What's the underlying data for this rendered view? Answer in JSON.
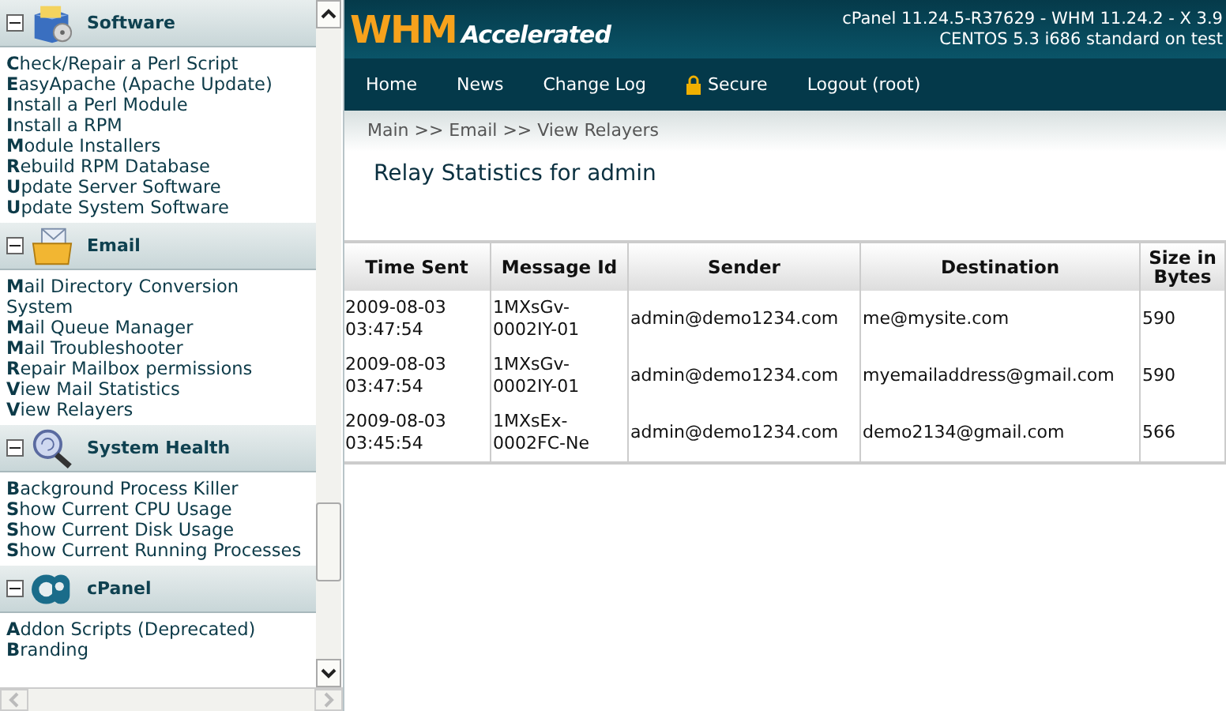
{
  "sidebar": {
    "sections": [
      {
        "title": "Software",
        "kind": "software",
        "expanded": true,
        "items": [
          "**C**heck/Repair a Perl Script",
          "**E**asyApache (Apache Update)",
          "**I**nstall a Perl Module",
          "**I**nstall a RPM",
          "**M**odule Installers",
          "**R**ebuild RPM Database",
          "**U**pdate Server Software",
          "**U**pdate System Software"
        ]
      },
      {
        "title": "Email",
        "kind": "email",
        "expanded": true,
        "items": [
          "**M**ail Directory Conversion System",
          "**M**ail Queue Manager",
          "**M**ail Troubleshooter",
          "**R**epair Mailbox permissions",
          "**V**iew Mail Statistics",
          "**V**iew Relayers"
        ]
      },
      {
        "title": "System Health",
        "kind": "health",
        "expanded": true,
        "items": [
          "**B**ackground Process Killer",
          "**S**how Current CPU Usage",
          "**S**how Current Disk Usage",
          "**S**how Current Running Processes"
        ]
      },
      {
        "title": "cPanel",
        "kind": "cpanel",
        "expanded": true,
        "items": [
          "**A**ddon Scripts (Deprecated)",
          "**B**randing"
        ]
      }
    ]
  },
  "header": {
    "logo_main": "WHM",
    "logo_sub": "Accelerated",
    "version": "cPanel 11.24.5-R37629 - WHM 11.24.2 - X 3.9",
    "system": "CENTOS 5.3 i686 standard on test"
  },
  "nav": [
    {
      "label": "Home",
      "kind": "link"
    },
    {
      "label": "News",
      "kind": "link"
    },
    {
      "label": "Change Log",
      "kind": "link"
    },
    {
      "label": "Secure",
      "kind": "lock"
    },
    {
      "label": "Logout (root)",
      "kind": "link"
    }
  ],
  "breadcrumb": "Main >> Email >> View Relayers",
  "heading": "Relay Statistics for admin",
  "table": {
    "columns": [
      "Time Sent",
      "Message Id",
      "Sender",
      "Destination",
      "Size in Bytes"
    ],
    "rows": [
      [
        "2009-08-03 03:47:54",
        "1MXsGv-0002IY-01",
        "admin@demo1234.com",
        "me@mysite.com",
        "590"
      ],
      [
        "2009-08-03 03:47:54",
        "1MXsGv-0002IY-01",
        "admin@demo1234.com",
        "myemailaddress@gmail.com",
        "590"
      ],
      [
        "2009-08-03 03:45:54",
        "1MXsEx-0002FC-Ne",
        "admin@demo1234.com",
        "demo2134@gmail.com",
        "566"
      ]
    ]
  }
}
